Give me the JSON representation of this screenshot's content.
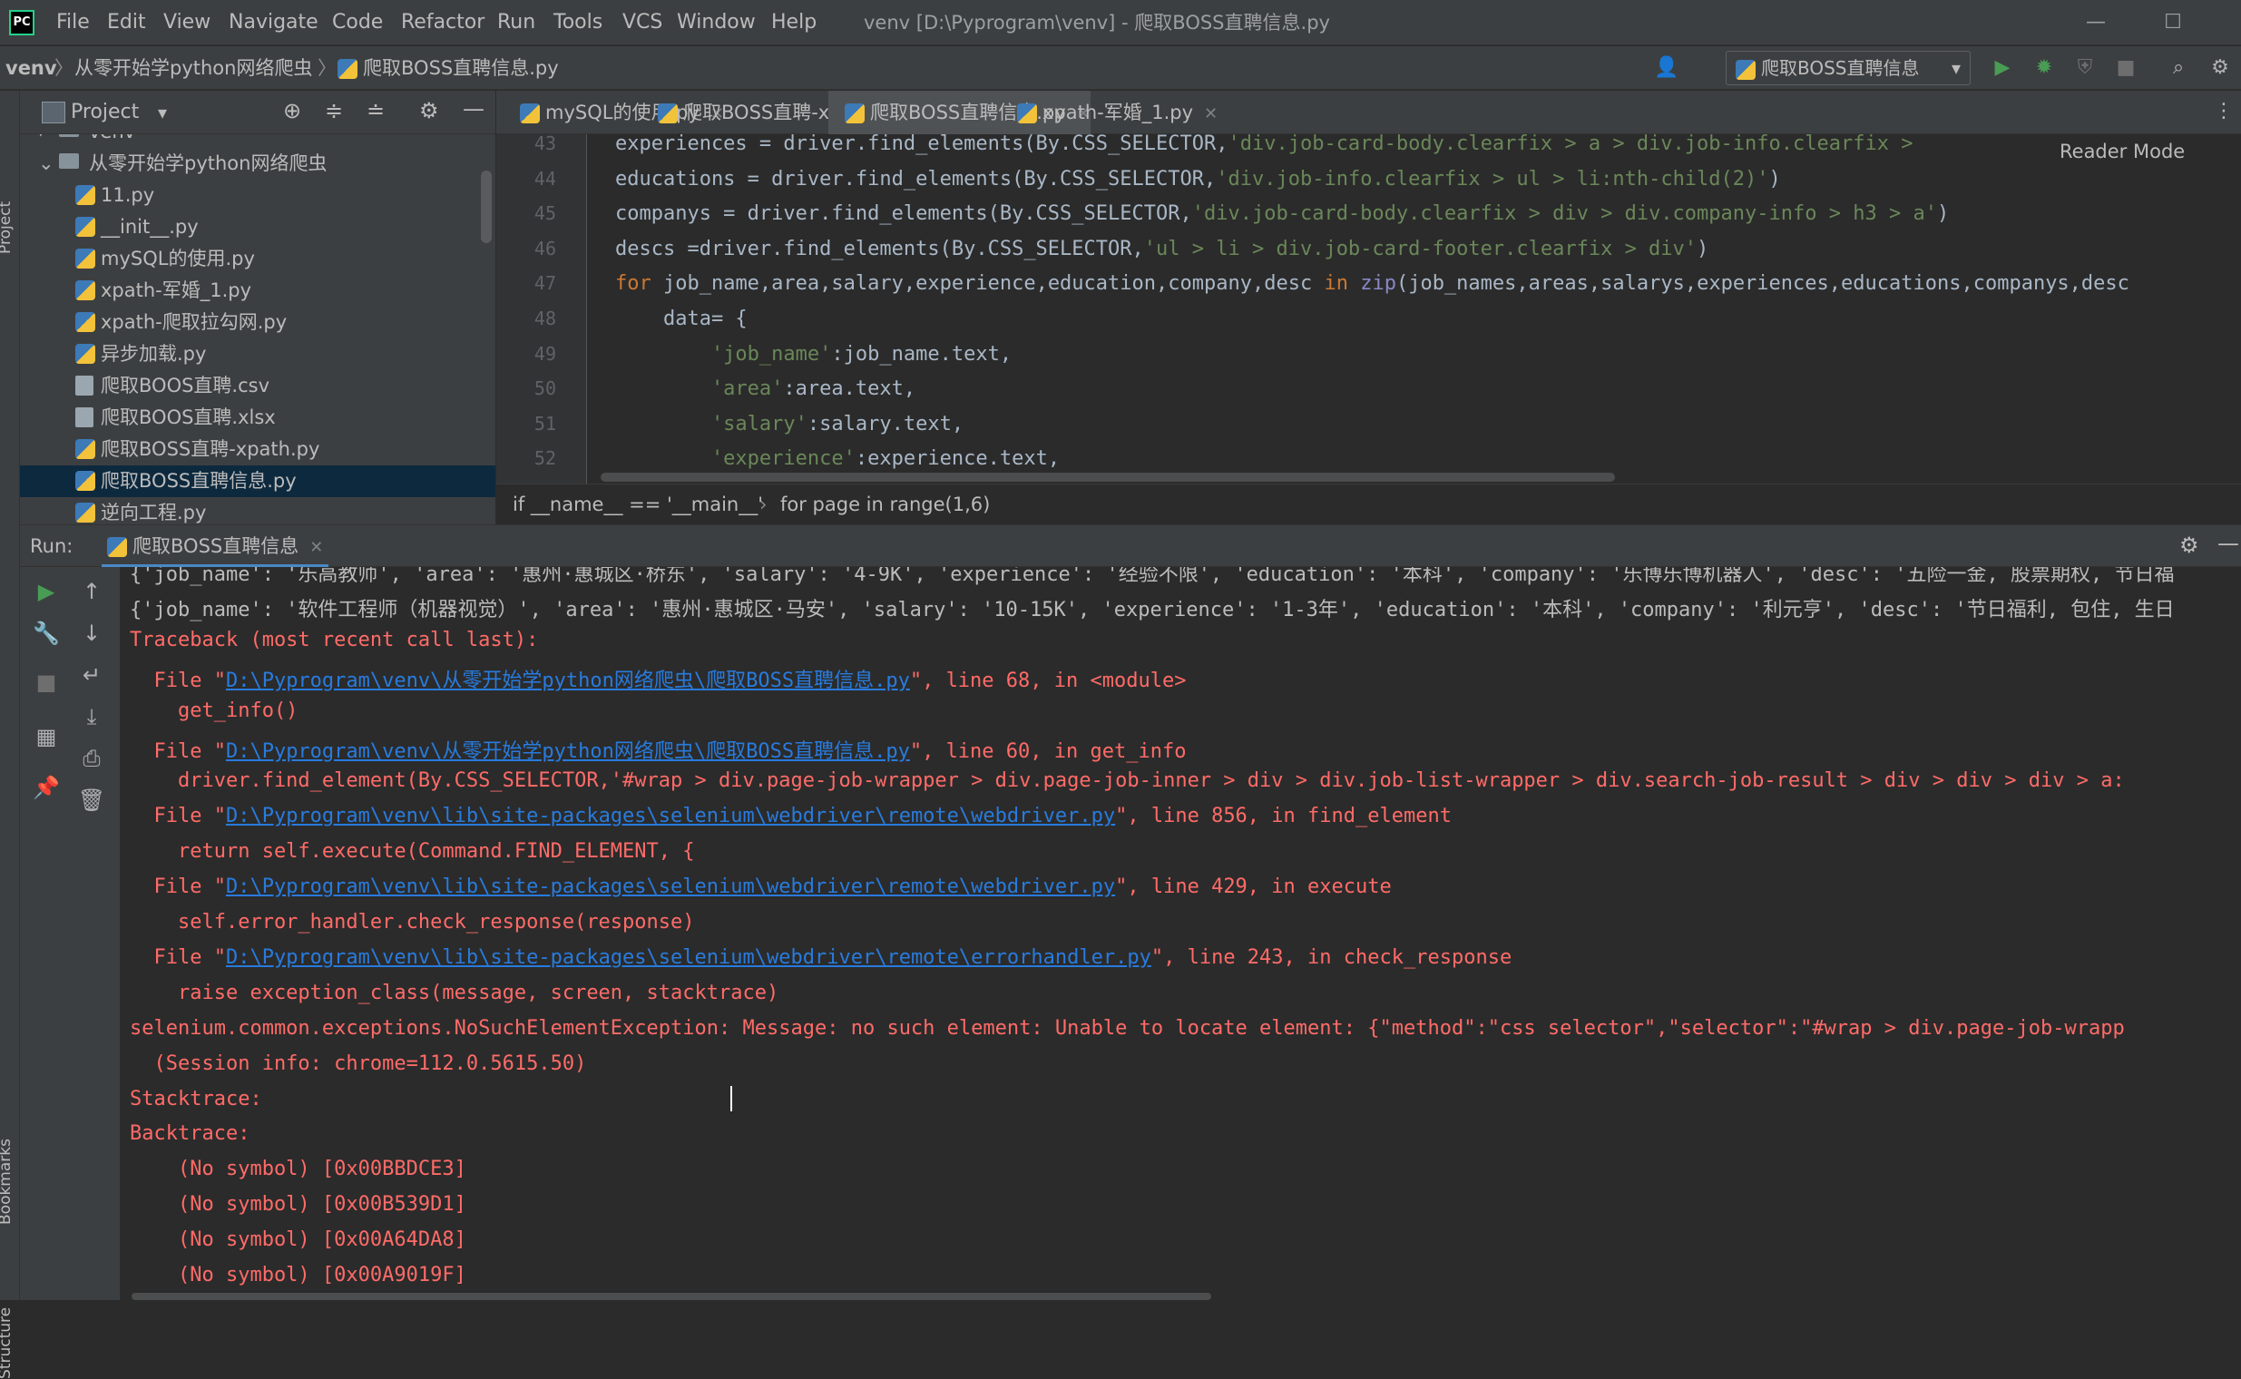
{
  "app": {
    "logo": "PC",
    "window_title": "venv [D:\\Pyprogram\\venv] - 爬取BOSS直聘信息.py"
  },
  "menu": [
    "File",
    "Edit",
    "View",
    "Navigate",
    "Code",
    "Refactor",
    "Run",
    "Tools",
    "VCS",
    "Window",
    "Help"
  ],
  "window_controls": {
    "minimize": "—",
    "maximize": "☐"
  },
  "navbar": {
    "crumbs": [
      "venv",
      "从零开始学python网络爬虫",
      "爬取BOSS直聘信息.py"
    ],
    "run_config": "爬取BOSS直聘信息"
  },
  "side_labels": {
    "project": "Project",
    "bookmarks": "Bookmarks",
    "structure": "Structure"
  },
  "project_panel": {
    "title": "Project",
    "tree": [
      {
        "label": "venv",
        "type": "folder",
        "indent": 1
      },
      {
        "label": "从零开始学python网络爬虫",
        "type": "folder",
        "indent": 1,
        "expanded": true
      },
      {
        "label": "11.py",
        "type": "py",
        "indent": 2
      },
      {
        "label": "__init__.py",
        "type": "py",
        "indent": 2
      },
      {
        "label": "mySQL的使用.py",
        "type": "py",
        "indent": 2
      },
      {
        "label": "xpath-军婚_1.py",
        "type": "py",
        "indent": 2
      },
      {
        "label": "xpath-爬取拉勾网.py",
        "type": "py",
        "indent": 2
      },
      {
        "label": "异步加载.py",
        "type": "py",
        "indent": 2
      },
      {
        "label": "爬取BOOS直聘.csv",
        "type": "csv",
        "indent": 2
      },
      {
        "label": "爬取BOOS直聘.xlsx",
        "type": "csv",
        "indent": 2
      },
      {
        "label": "爬取BOSS直聘-xpath.py",
        "type": "py",
        "indent": 2
      },
      {
        "label": "爬取BOSS直聘信息.py",
        "type": "py",
        "indent": 2,
        "selected": true
      },
      {
        "label": "逆向工程.py",
        "type": "py",
        "indent": 2
      }
    ]
  },
  "editor_tabs": [
    {
      "label": "mySQL的使用.py",
      "active": false
    },
    {
      "label": "爬取BOSS直聘-xpath.py",
      "active": false
    },
    {
      "label": "爬取BOSS直聘信息.py",
      "active": true
    },
    {
      "label": "xpath-军婚_1.py",
      "active": false
    }
  ],
  "editor": {
    "reader_mode": "Reader Mode",
    "lines": [
      {
        "n": "43",
        "tokens": [
          [
            "",
            "    experiences = driver.find_elements(By.CSS_SELECTOR,"
          ],
          [
            "str",
            "'div.job-card-body.clearfix > a > div.job-info.clearfix >"
          ]
        ]
      },
      {
        "n": "44",
        "tokens": [
          [
            "",
            "    educations = driver.find_elements(By.CSS_SELECTOR,"
          ],
          [
            "str",
            "'div.job-info.clearfix > ul > li:nth-child(2)'"
          ],
          [
            "",
            ")"
          ]
        ]
      },
      {
        "n": "45",
        "tokens": [
          [
            "",
            "    companys = driver.find_elements(By.CSS_SELECTOR,"
          ],
          [
            "str",
            "'div.job-card-body.clearfix > div > div.company-info > h3 > a'"
          ],
          [
            "",
            ")"
          ]
        ]
      },
      {
        "n": "46",
        "tokens": [
          [
            "",
            "    descs =driver.find_elements(By.CSS_SELECTOR,"
          ],
          [
            "str",
            "'ul > li > div.job-card-footer.clearfix > div'"
          ],
          [
            "",
            ")"
          ]
        ]
      },
      {
        "n": "47",
        "tokens": [
          [
            "kw",
            "    for "
          ],
          [
            "",
            "job_name,area,salary,experience,education,company,desc "
          ],
          [
            "kw",
            "in "
          ],
          [
            "bi",
            "zip"
          ],
          [
            "",
            "(job_names,areas,salarys,experiences,educations,companys,desc"
          ]
        ]
      },
      {
        "n": "48",
        "tokens": [
          [
            "",
            "        data= {"
          ]
        ]
      },
      {
        "n": "49",
        "tokens": [
          [
            "str",
            "            'job_name'"
          ],
          [
            "",
            ":job_name.text,"
          ]
        ]
      },
      {
        "n": "50",
        "tokens": [
          [
            "str",
            "            'area'"
          ],
          [
            "",
            ":area.text,"
          ]
        ]
      },
      {
        "n": "51",
        "tokens": [
          [
            "str",
            "            'salary'"
          ],
          [
            "",
            ":salary.text,"
          ]
        ]
      },
      {
        "n": "52",
        "tokens": [
          [
            "str",
            "            'experience'"
          ],
          [
            "",
            ":experience.text,"
          ]
        ]
      }
    ],
    "breadcrumb": [
      "if __name__ == '__main__'",
      "for page in range(1,6)"
    ]
  },
  "run": {
    "label": "Run:",
    "tab": "爬取BOSS直聘信息",
    "console": [
      {
        "c": "w",
        "parts": [
          [
            "",
            "{'job_name': '乐高教师', 'area': '惠州·惠城区·桥东', 'salary': '4-9K', 'experience': '经验不限', 'education': '本科', 'company': '乐博乐博机器人', 'desc': '五险一金, 股票期权, 节日福"
          ]
        ]
      },
      {
        "c": "w",
        "parts": [
          [
            "",
            "{'job_name': '软件工程师（机器视觉）', 'area': '惠州·惠城区·马安', 'salary': '10-15K', 'experience': '1-3年', 'education': '本科', 'company': '利元亨', 'desc': '节日福利, 包住, 生日"
          ]
        ]
      },
      {
        "c": "r",
        "parts": [
          [
            "",
            "Traceback (most recent call last):"
          ]
        ]
      },
      {
        "c": "r",
        "parts": [
          [
            "",
            "  File \""
          ],
          [
            "link",
            "D:\\Pyprogram\\venv\\从零开始学python网络爬虫\\爬取BOSS直聘信息.py"
          ],
          [
            "",
            "\", line 68, in <module>"
          ]
        ]
      },
      {
        "c": "r",
        "parts": [
          [
            "",
            "    get_info()"
          ]
        ]
      },
      {
        "c": "r",
        "parts": [
          [
            "",
            "  File \""
          ],
          [
            "link",
            "D:\\Pyprogram\\venv\\从零开始学python网络爬虫\\爬取BOSS直聘信息.py"
          ],
          [
            "",
            "\", line 60, in get_info"
          ]
        ]
      },
      {
        "c": "r",
        "parts": [
          [
            "",
            "    driver.find_element(By.CSS_SELECTOR,'#wrap > div.page-job-wrapper > div.page-job-inner > div > div.job-list-wrapper > div.search-job-result > div > div > div > a:"
          ]
        ]
      },
      {
        "c": "r",
        "parts": [
          [
            "",
            "  File \""
          ],
          [
            "link",
            "D:\\Pyprogram\\venv\\lib\\site-packages\\selenium\\webdriver\\remote\\webdriver.py"
          ],
          [
            "",
            "\", line 856, in find_element"
          ]
        ]
      },
      {
        "c": "r",
        "parts": [
          [
            "",
            "    return self.execute(Command.FIND_ELEMENT, {"
          ]
        ]
      },
      {
        "c": "r",
        "parts": [
          [
            "",
            "  File \""
          ],
          [
            "link",
            "D:\\Pyprogram\\venv\\lib\\site-packages\\selenium\\webdriver\\remote\\webdriver.py"
          ],
          [
            "",
            "\", line 429, in execute"
          ]
        ]
      },
      {
        "c": "r",
        "parts": [
          [
            "",
            "    self.error_handler.check_response(response)"
          ]
        ]
      },
      {
        "c": "r",
        "parts": [
          [
            "",
            "  File \""
          ],
          [
            "link",
            "D:\\Pyprogram\\venv\\lib\\site-packages\\selenium\\webdriver\\remote\\errorhandler.py"
          ],
          [
            "",
            "\", line 243, in check_response"
          ]
        ]
      },
      {
        "c": "r",
        "parts": [
          [
            "",
            "    raise exception_class(message, screen, stacktrace)"
          ]
        ]
      },
      {
        "c": "r",
        "parts": [
          [
            "",
            "selenium.common.exceptions.NoSuchElementException: Message: no such element: Unable to locate element: {\"method\":\"css selector\",\"selector\":\"#wrap > div.page-job-wrapp"
          ]
        ]
      },
      {
        "c": "r",
        "parts": [
          [
            "",
            "  (Session info: chrome=112.0.5615.50)"
          ]
        ]
      },
      {
        "c": "r",
        "parts": [
          [
            "",
            "Stacktrace:"
          ]
        ]
      },
      {
        "c": "r",
        "parts": [
          [
            "",
            "Backtrace:"
          ]
        ]
      },
      {
        "c": "r",
        "parts": [
          [
            "",
            "    (No symbol) [0x00BBDCE3]"
          ]
        ]
      },
      {
        "c": "r",
        "parts": [
          [
            "",
            "    (No symbol) [0x00B539D1]"
          ]
        ]
      },
      {
        "c": "r",
        "parts": [
          [
            "",
            "    (No symbol) [0x00A64DA8]"
          ]
        ]
      },
      {
        "c": "r",
        "parts": [
          [
            "",
            "    (No symbol) [0x00A9019F]"
          ]
        ]
      }
    ]
  },
  "colors": {
    "accent": "#4a88c7",
    "error": "#ff6b68",
    "link": "#287bde",
    "run_green": "#499c54",
    "selection": "#0d293e"
  }
}
